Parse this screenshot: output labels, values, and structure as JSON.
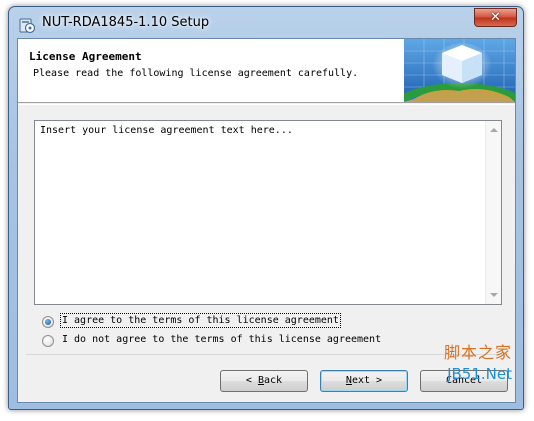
{
  "window": {
    "title": "NUT-RDA1845-1.10 Setup",
    "close_label": "✕"
  },
  "header": {
    "title": "License Agreement",
    "subtitle": "Please read the following license agreement carefully."
  },
  "license": {
    "text": "Insert your license agreement text here..."
  },
  "options": [
    {
      "label": "I agree to the terms of this license agreement",
      "checked": true
    },
    {
      "label": "I do not agree to the terms of this license agreement",
      "checked": false
    }
  ],
  "buttons": {
    "back_prefix": "< ",
    "back_accel": "B",
    "back_rest": "ack",
    "next_accel": "N",
    "next_rest": "ext >",
    "cancel_label": "Cancel"
  },
  "watermark": {
    "line1": "脚本之家",
    "line2": "JB51.Net"
  },
  "colors": {
    "accent": "#3c7fb1",
    "watermark_orange": "#d9701f",
    "watermark_blue": "#1f8fd6"
  }
}
